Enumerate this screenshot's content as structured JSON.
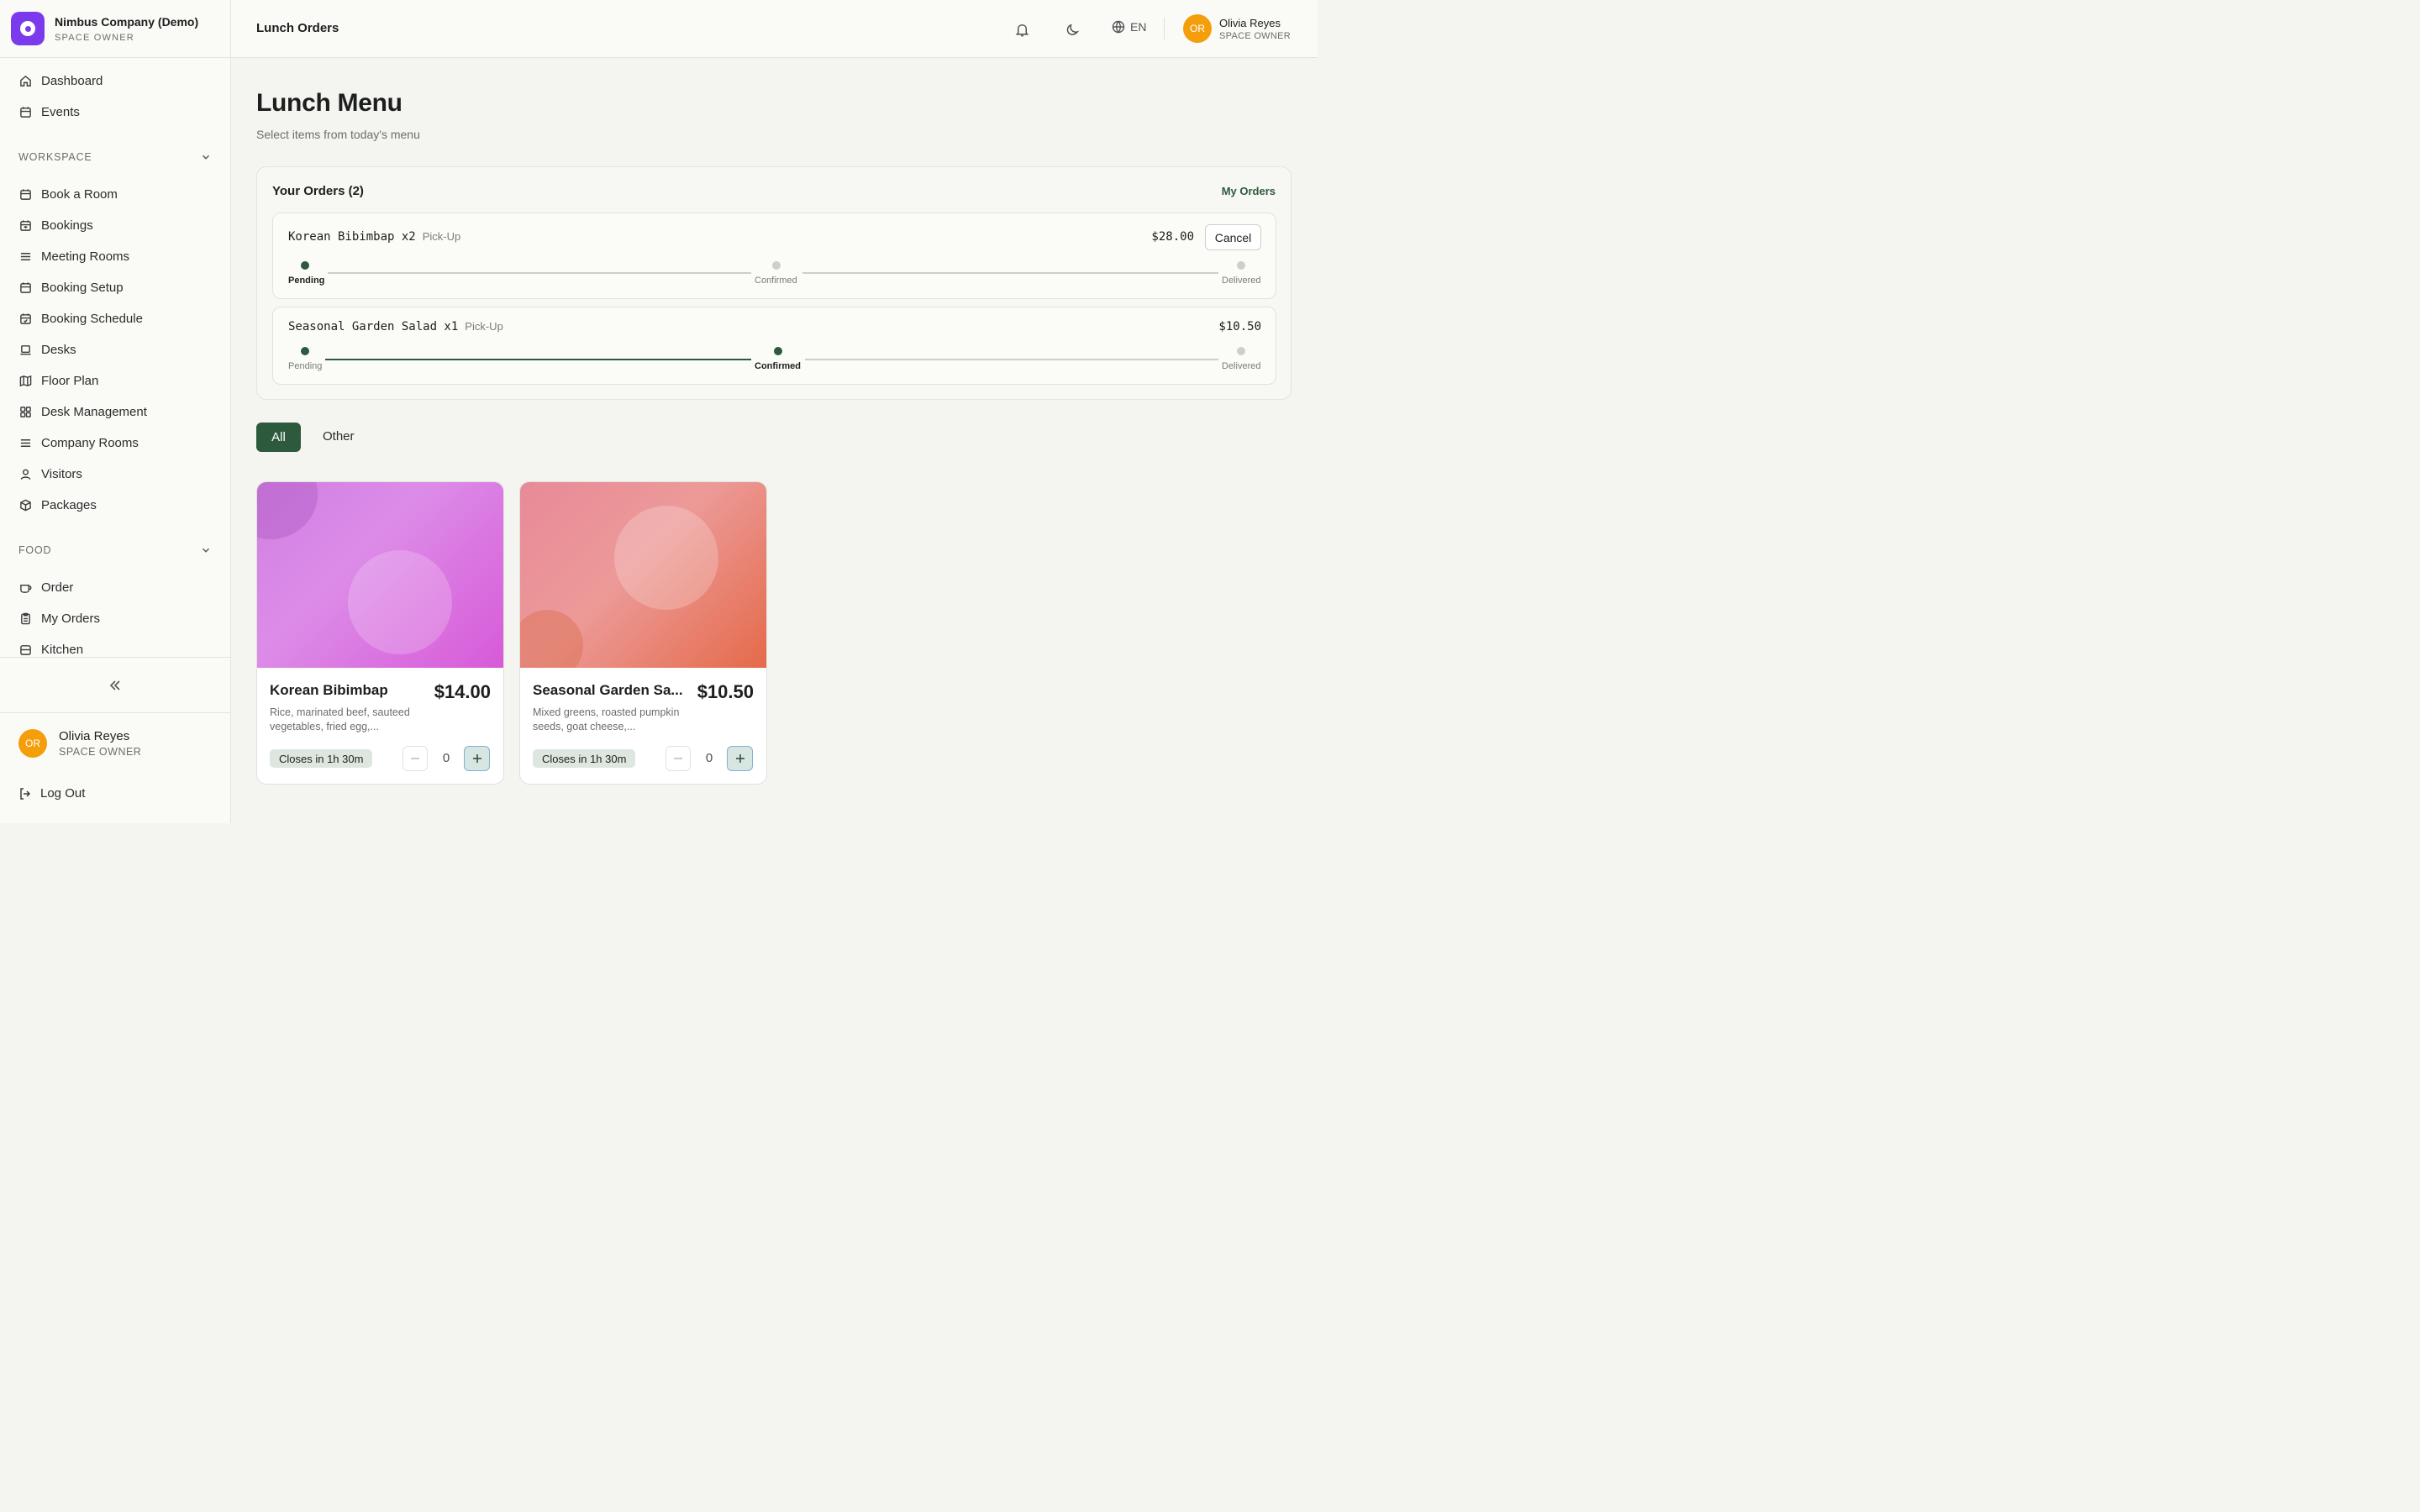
{
  "brand": {
    "name": "Nimbus Company (Demo)",
    "role": "SPACE OWNER",
    "color": "#7c3aed"
  },
  "header": {
    "title": "Lunch Orders",
    "language": "EN",
    "icons": [
      "bell-icon",
      "moon-icon",
      "globe-icon"
    ]
  },
  "user": {
    "initials": "OR",
    "name": "Olivia Reyes",
    "role": "SPACE OWNER"
  },
  "sidebar": {
    "top_items": [
      {
        "label": "Dashboard",
        "icon": "home-icon"
      },
      {
        "label": "Events",
        "icon": "calendar-icon"
      }
    ],
    "workspace": {
      "title": "WORKSPACE",
      "items": [
        {
          "label": "Book a Room",
          "icon": "calendar-icon"
        },
        {
          "label": "Bookings",
          "icon": "calendar-list-icon"
        },
        {
          "label": "Meeting Rooms",
          "icon": "menu-icon"
        },
        {
          "label": "Booking Setup",
          "icon": "calendar-icon"
        },
        {
          "label": "Booking Schedule",
          "icon": "calendar-check-icon"
        },
        {
          "label": "Desks",
          "icon": "laptop-icon"
        },
        {
          "label": "Floor Plan",
          "icon": "map-icon"
        },
        {
          "label": "Desk Management",
          "icon": "grid-icon"
        },
        {
          "label": "Company Rooms",
          "icon": "menu-icon"
        },
        {
          "label": "Visitors",
          "icon": "user-icon"
        },
        {
          "label": "Packages",
          "icon": "package-icon"
        }
      ]
    },
    "food": {
      "title": "FOOD",
      "items": [
        {
          "label": "Order",
          "icon": "cup-icon"
        },
        {
          "label": "My Orders",
          "icon": "clipboard-icon"
        },
        {
          "label": "Kitchen",
          "icon": "kitchen-icon"
        }
      ]
    },
    "logout_label": "Log Out"
  },
  "main": {
    "title": "Lunch Menu",
    "subtitle": "Select items from today's menu",
    "orders": {
      "heading": "Your Orders (2)",
      "link": "My Orders",
      "items": [
        {
          "name": "Korean Bibimbap x2",
          "type": "Pick-Up",
          "price": "$28.00",
          "cancel_label": "Cancel",
          "status": "Pending",
          "steps": [
            "Pending",
            "Confirmed",
            "Delivered"
          ]
        },
        {
          "name": "Seasonal Garden Salad x1",
          "type": "Pick-Up",
          "price": "$10.50",
          "status": "Confirmed",
          "steps": [
            "Pending",
            "Confirmed",
            "Delivered"
          ]
        }
      ]
    },
    "filters": {
      "all": "All",
      "other": "Other"
    },
    "menu_items": [
      {
        "name": "Korean Bibimbap",
        "price": "$14.00",
        "description": "Rice, marinated beef, sauteed vegetables, fried egg,...",
        "closes": "Closes in 1h 30m",
        "quantity": "0"
      },
      {
        "name": "Seasonal Garden Sa...",
        "price": "$10.50",
        "description": "Mixed greens, roasted pumpkin seeds, goat cheese,...",
        "closes": "Closes in 1h 30m",
        "quantity": "0"
      }
    ]
  },
  "colors": {
    "accent": "#2d5a3d",
    "avatar": "#f59e0b",
    "step_inactive": "#cfcfc5"
  }
}
